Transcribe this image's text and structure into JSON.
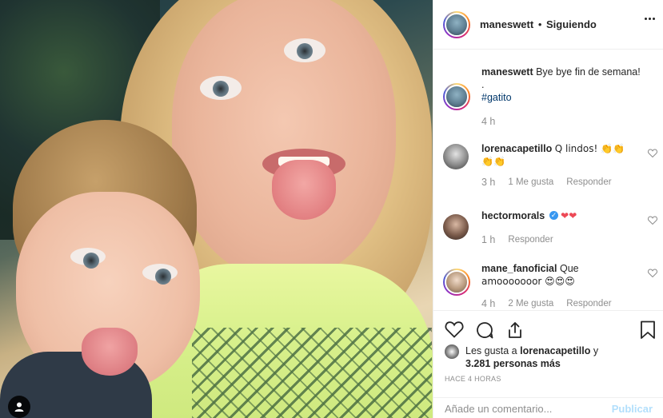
{
  "post": {
    "author": "maneswett",
    "separator": "•",
    "follow_status": "Siguiendo",
    "caption": "Bye bye fin de semana!",
    "caption_dot": ".",
    "hashtag": "#gatito",
    "time": "4 h"
  },
  "comments": [
    {
      "user": "lorenacapetillo",
      "text": "Q lindos! 👏👏",
      "text2": "👏👏",
      "time": "3 h",
      "likes": "1 Me gusta",
      "reply": "Responder",
      "avatar_color": "#7c7c7c"
    },
    {
      "user": "hectormorals",
      "verified": true,
      "text": "❤❤",
      "time": "1 h",
      "reply": "Responder",
      "avatar_color": "#5a4a43"
    },
    {
      "user": "mane_fanoficial",
      "text": "Que",
      "text2": "amooooooor 😍😍😍",
      "time": "4 h",
      "likes": "2 Me gusta",
      "reply": "Responder",
      "avatar_color": "#b89a7e"
    }
  ],
  "actions": {
    "likes_prefix": "Les gusta a",
    "likes_user": "lorenacapetillo",
    "likes_and": "y",
    "likes_count": "3.281 personas más",
    "timestamp": "HACE 4 HORAS",
    "comment_placeholder": "Añade un comentario...",
    "publish_label": "Publicar"
  },
  "icons": {
    "like": "heart-outline-icon",
    "comment": "comment-bubble-icon",
    "share": "share-icon",
    "save": "bookmark-icon",
    "more": "more-options-icon",
    "tag": "user-tag-icon"
  },
  "colors": {
    "text": "#262626",
    "muted": "#8e8e8e",
    "link": "#00376b",
    "verified": "#3897f0",
    "publish_disabled": "#b2dffc",
    "heart_red": "#ed4956"
  }
}
